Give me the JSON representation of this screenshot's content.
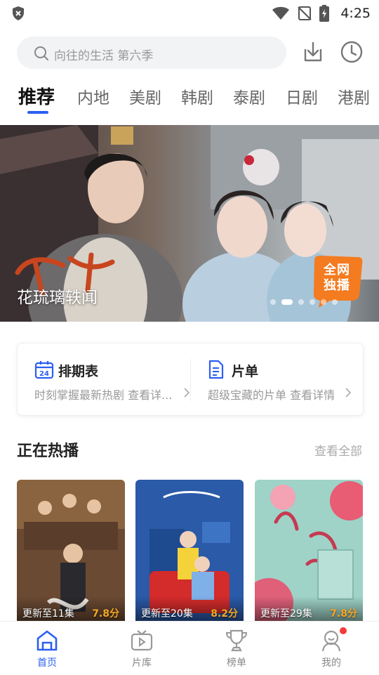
{
  "status_bar": {
    "time": "4:25"
  },
  "search": {
    "placeholder": "向往的生活 第六季"
  },
  "tabs": [
    {
      "label": "推荐",
      "active": true
    },
    {
      "label": "内地"
    },
    {
      "label": "美剧"
    },
    {
      "label": "韩剧"
    },
    {
      "label": "泰剧"
    },
    {
      "label": "日剧"
    },
    {
      "label": "港剧"
    }
  ],
  "banner": {
    "title": "花琉璃轶闻",
    "badge_line1": "全网",
    "badge_line2": "独播",
    "page_count": 6,
    "active_page": 2
  },
  "quick_links": [
    {
      "title": "排期表",
      "subtitle": "时刻掌握最新热剧 查看详...",
      "icon": "calendar-icon"
    },
    {
      "title": "片单",
      "subtitle": "超级宝藏的片单 查看详情",
      "icon": "document-icon"
    }
  ],
  "hot_section": {
    "title": "正在热播",
    "see_all": "查看全部",
    "items": [
      {
        "episodes": "更新至11集",
        "score": "7.8分"
      },
      {
        "episodes": "更新至20集",
        "score": "8.2分"
      },
      {
        "episodes": "更新至29集",
        "score": "7.8分"
      }
    ]
  },
  "bottom_nav": [
    {
      "label": "首页",
      "icon": "home-icon",
      "active": true
    },
    {
      "label": "片库",
      "icon": "tv-library-icon"
    },
    {
      "label": "榜单",
      "icon": "trophy-icon"
    },
    {
      "label": "我的",
      "icon": "profile-icon",
      "has_badge": true
    }
  ],
  "colors": {
    "accent": "#2c5ff2",
    "score": "#f6a623",
    "badge": "#f47b20",
    "notify": "#f23b3b"
  }
}
